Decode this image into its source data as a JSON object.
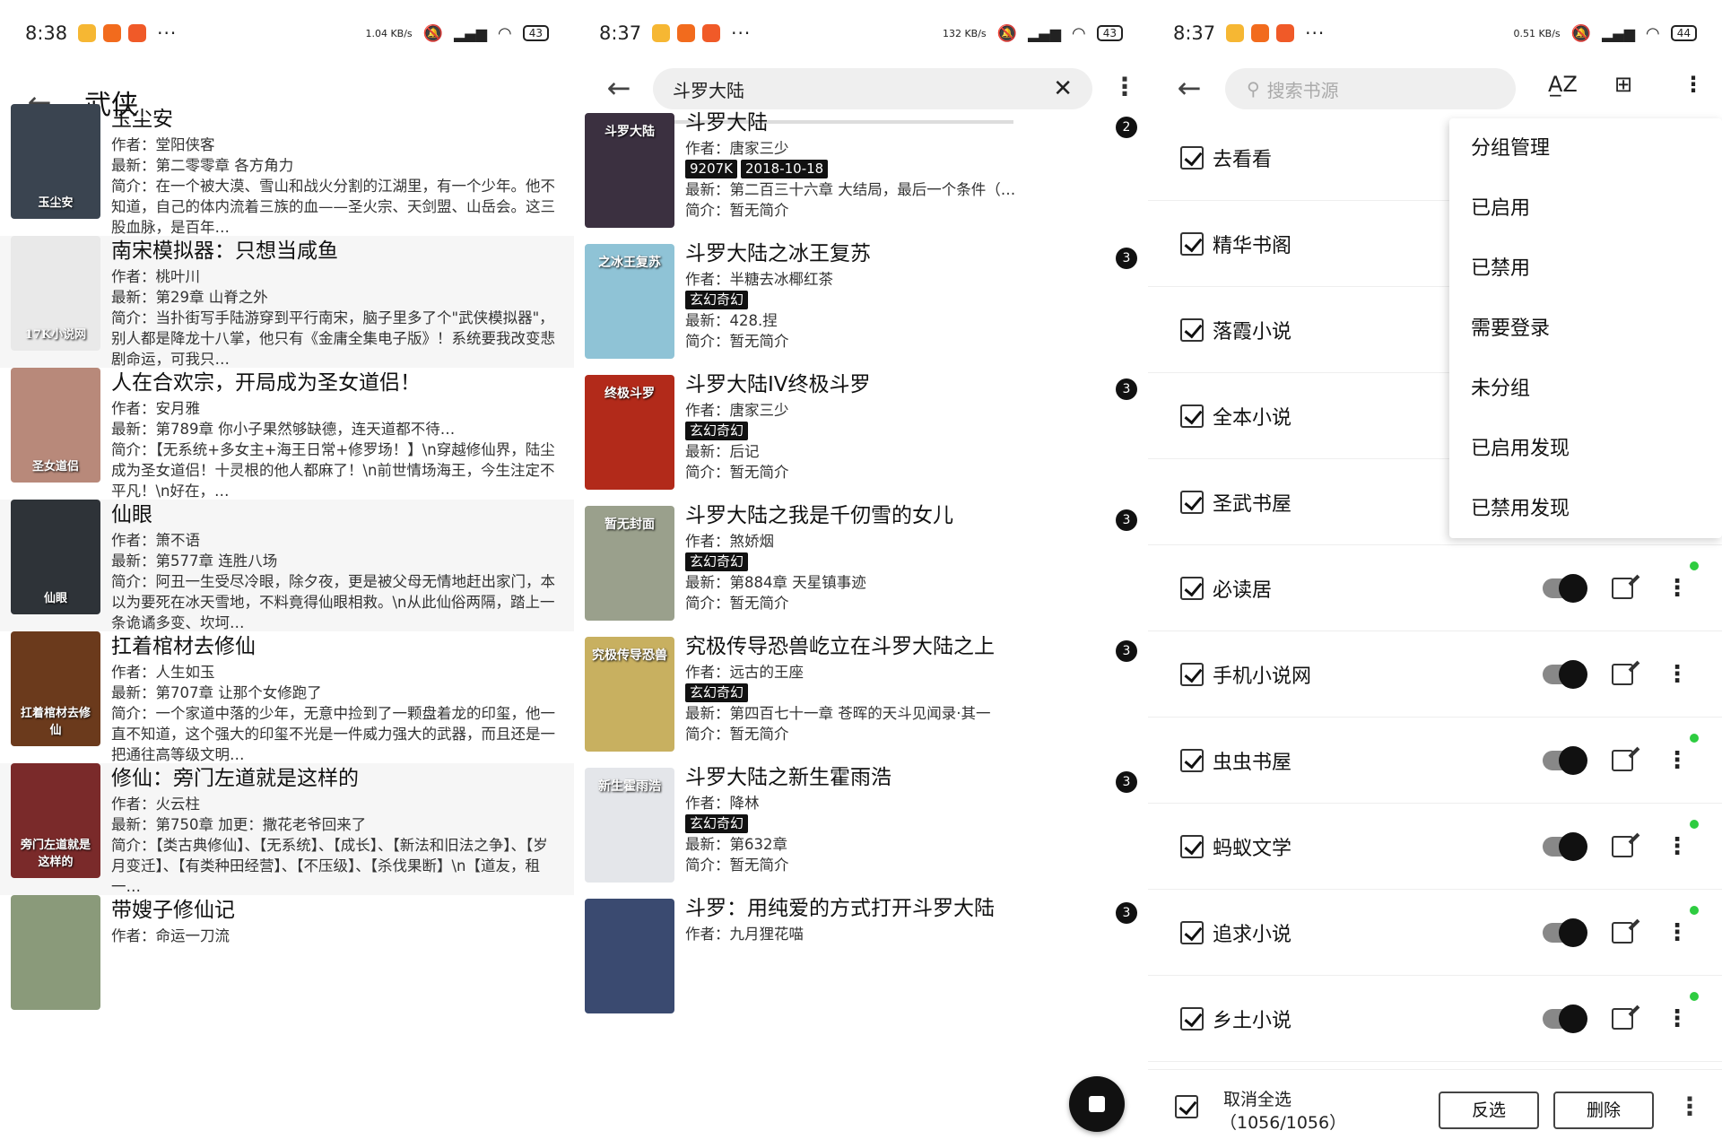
{
  "colors": {
    "accent": "#111111",
    "online": "#2ecc40",
    "switch_track": "#888888"
  },
  "screen1": {
    "status": {
      "time": "8:38",
      "speed": "1.04 KB/s",
      "battery": "43"
    },
    "title": "武侠",
    "books": [
      {
        "name": "玉尘安",
        "author": "作者：堂阳侠客",
        "latest": "最新：第二零零章 各方角力",
        "intro": "简介：在一个被大漠、雪山和战火分割的江湖里，有一个少年。他不知道，自己的体内流着三族的血——圣火宗、天剑盟、山岳会。这三股血脉，是百年…",
        "cover_text": "玉尘安",
        "cover_bg": "#3a4450"
      },
      {
        "name": "南宋模拟器：只想当咸鱼",
        "author": "作者：桃叶川",
        "latest": "最新：第29章 山脊之外",
        "intro": "简介：当扑街写手陆游穿到平行南宋，脑子里多了个\"武侠模拟器\"，别人都是降龙十八掌，他只有《金庸全集电子版》！系统要我改变悲剧命运，可我只…",
        "cover_text": "17K小说网",
        "cover_bg": "#e9e9e9"
      },
      {
        "name": "人在合欢宗，开局成为圣女道侣！",
        "author": "作者：安月雅",
        "latest": "最新：第789章 你小子果然够缺德，连天道都不待…",
        "intro": "简介：【无系统+多女主+海王日常+修罗场！】\\n穿越修仙界，陆尘成为圣女道侣！十灵根的他人都麻了！\\n前世情场海王，今生注定不平凡！\\n好在，…",
        "cover_text": "圣女道侣",
        "cover_bg": "#b8897a"
      },
      {
        "name": "仙眼",
        "author": "作者：箫不语",
        "latest": "最新：第577章 连胜八场",
        "intro": "简介：阿丑一生受尽冷眼，除夕夜，更是被父母无情地赶出家门，本以为要死在冰天雪地，不料竟得仙眼相救。\\n从此仙俗两隔，踏上一条诡谲多变、坎坷…",
        "cover_text": "仙眼",
        "cover_bg": "#2e3338"
      },
      {
        "name": "扛着棺材去修仙",
        "author": "作者：人生如玉",
        "latest": "最新：第707章 让那个女修跑了",
        "intro": "简介：一个家道中落的少年，无意中捡到了一颗盘着龙的印玺，他一直不知道，这个强大的印玺不光是一件威力强大的武器，而且还是一把通往高等级文明…",
        "cover_text": "扛着棺材去修仙",
        "cover_bg": "#6b3a1c"
      },
      {
        "name": "修仙：旁门左道就是这样的",
        "author": "作者：火云柱",
        "latest": "最新：第750章 加更：撒花老爷回来了",
        "intro": "简介：【类古典修仙】、【无系统】、【成长】、【新法和旧法之争】、【岁月变迁】、【有类种田经营】、【不压级】、【杀伐果断】\\n【道友，租一…",
        "cover_text": "旁门左道就是这样的",
        "cover_bg": "#7a2a2a"
      },
      {
        "name": "带嫂子修仙记",
        "author": "作者：命运一刀流",
        "latest": "",
        "intro": "",
        "cover_text": "",
        "cover_bg": "#8a9a7a"
      }
    ]
  },
  "screen2": {
    "status": {
      "time": "8:37",
      "speed": "132 KB/s",
      "battery": "43"
    },
    "query": "斗罗大陆",
    "books": [
      {
        "name": "斗罗大陆",
        "author": "作者：唐家三少",
        "tags": [
          "9207K",
          "2018-10-18"
        ],
        "latest": "最新：第二百三十六章 大结局，最后一个条件（…",
        "intro": "简介：暂无简介",
        "count": "2",
        "cover_text": "斗罗大陆",
        "cover_bg": "#3b3040"
      },
      {
        "name": "斗罗大陆之冰王复苏",
        "author": "作者：半糖去冰椰红茶",
        "tags": [
          "玄幻奇幻"
        ],
        "latest": "最新：428.捏",
        "intro": "简介：暂无简介",
        "count": "3",
        "cover_text": "之冰王复苏",
        "cover_bg": "#8fc3d6"
      },
      {
        "name": "斗罗大陆IV终极斗罗",
        "author": "作者：唐家三少",
        "tags": [
          "玄幻奇幻"
        ],
        "latest": "最新：后记",
        "intro": "简介：暂无简介",
        "count": "3",
        "cover_text": "终极斗罗",
        "cover_bg": "#b22a1a"
      },
      {
        "name": "斗罗大陆之我是千仞雪的女儿",
        "author": "作者：煞娇烟",
        "tags": [
          "玄幻奇幻"
        ],
        "latest": "最新：第884章 天星镇事迹",
        "intro": "简介：暂无简介",
        "count": "3",
        "cover_text": "暂无封面",
        "cover_bg": "#9aa08c"
      },
      {
        "name": "究极传导恐兽屹立在斗罗大陆之上",
        "author": "作者：远古的王座",
        "tags": [
          "玄幻奇幻"
        ],
        "latest": "最新：第四百七十一章 苍晖的天斗见闻录·其一",
        "intro": "简介：暂无简介",
        "count": "3",
        "cover_text": "究极传导恐兽",
        "cover_bg": "#c8b060"
      },
      {
        "name": "斗罗大陆之新生霍雨浩",
        "author": "作者：降林",
        "tags": [
          "玄幻奇幻"
        ],
        "latest": "最新：第632章",
        "intro": "简介：暂无简介",
        "count": "3",
        "cover_text": "新生霍雨浩",
        "cover_bg": "#e4e6ea"
      },
      {
        "name": "斗罗：用纯爱的方式打开斗罗大陆",
        "author": "作者：九月狸花喵",
        "tags": [],
        "latest": "",
        "intro": "",
        "count": "3",
        "cover_text": "",
        "cover_bg": "#3a4a70"
      }
    ]
  },
  "screen3": {
    "status": {
      "time": "8:37",
      "speed": "0.51 KB/s",
      "battery": "44"
    },
    "search_placeholder": "搜索书源",
    "sources": [
      {
        "name": "去看看",
        "dot": false
      },
      {
        "name": "精华书阁",
        "dot": false
      },
      {
        "name": "落霞小说",
        "dot": false
      },
      {
        "name": "全本小说",
        "dot": false
      },
      {
        "name": "圣武书屋",
        "dot": false
      },
      {
        "name": "必读居",
        "dot": true
      },
      {
        "name": "手机小说网",
        "dot": false
      },
      {
        "name": "虫虫书屋",
        "dot": true
      },
      {
        "name": "蚂蚁文学",
        "dot": true
      },
      {
        "name": "追求小说",
        "dot": true
      },
      {
        "name": "乡土小说",
        "dot": true
      }
    ],
    "menu": [
      "分组管理",
      "已启用",
      "已禁用",
      "需要登录",
      "未分组",
      "已启用发现",
      "已禁用发现"
    ],
    "bottom": {
      "select_label": "取消全选",
      "select_count": "（1056/1056）",
      "invert": "反选",
      "delete": "删除"
    }
  }
}
